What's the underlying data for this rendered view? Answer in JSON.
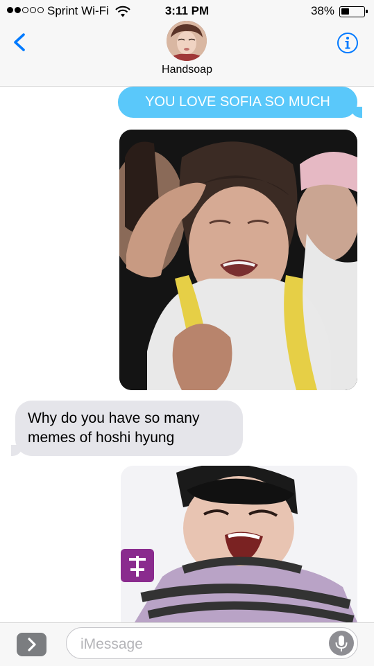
{
  "status_bar": {
    "carrier": "Sprint Wi-Fi",
    "time": "3:11 PM",
    "battery_percent_text": "38%",
    "battery_level": 0.38,
    "signal_bars_filled": 2,
    "signal_bars_total": 5
  },
  "header": {
    "contact_name": "Handsoap",
    "back_icon": "chevron-left-icon",
    "info_icon": "info-icon"
  },
  "messages": [
    {
      "direction": "outgoing",
      "type": "text",
      "text": "YOU LOVE SOFIA SO MUCH"
    },
    {
      "direction": "outgoing",
      "type": "image"
    },
    {
      "direction": "incoming",
      "type": "text",
      "text": "Why do you have so many memes of hoshi hyung"
    },
    {
      "direction": "outgoing",
      "type": "image"
    }
  ],
  "input_bar": {
    "placeholder": "iMessage",
    "apps_icon": "chevron-right-icon",
    "mic_icon": "microphone-icon"
  },
  "colors": {
    "accent": "#007aff",
    "outgoing_bubble": "#5ac8fa",
    "incoming_bubble": "#e5e5ea"
  }
}
